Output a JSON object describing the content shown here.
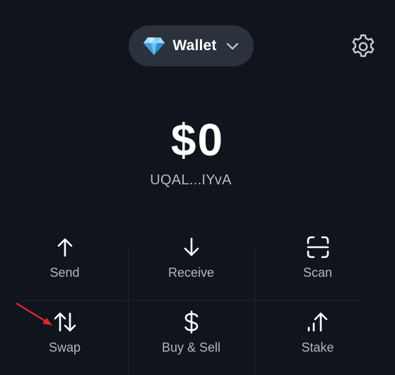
{
  "header": {
    "wallet_label": "Wallet",
    "wallet_icon": "diamond-icon",
    "dropdown_icon": "chevron-down-icon",
    "settings_icon": "gear-icon"
  },
  "balance": {
    "amount": "$0",
    "address": "UQAL...IYvA"
  },
  "actions": [
    {
      "label": "Send",
      "icon": "arrow-up-icon"
    },
    {
      "label": "Receive",
      "icon": "arrow-down-icon"
    },
    {
      "label": "Scan",
      "icon": "scan-icon"
    },
    {
      "label": "Swap",
      "icon": "swap-icon"
    },
    {
      "label": "Buy & Sell",
      "icon": "dollar-icon"
    },
    {
      "label": "Stake",
      "icon": "stake-icon"
    }
  ],
  "colors": {
    "background": "#10151d",
    "pill": "#2b323d",
    "gem": "#5fb8f0",
    "label_muted": "#b0b7c1",
    "annotation": "#e0282a"
  }
}
